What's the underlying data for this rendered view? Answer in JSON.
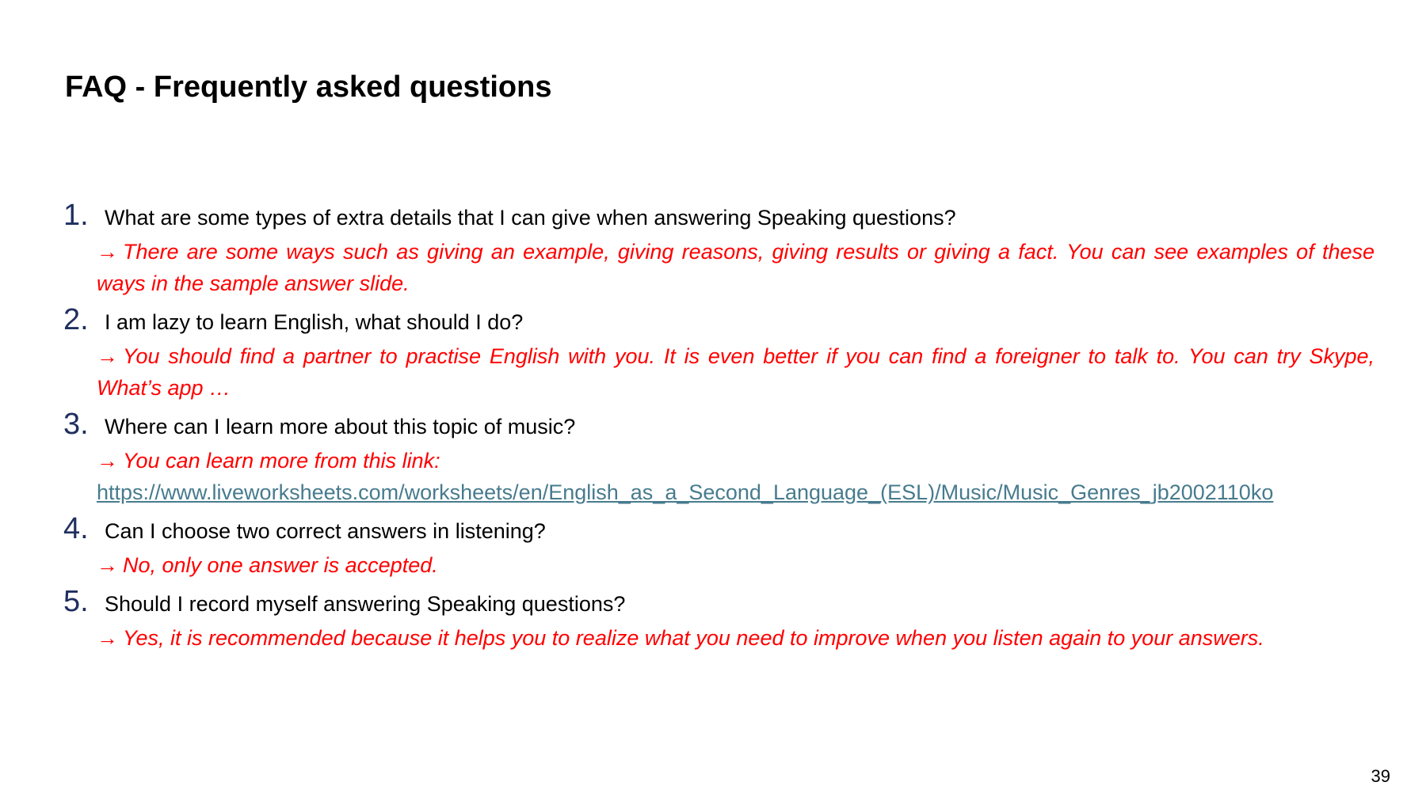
{
  "slide": {
    "title": "FAQ - Frequently asked questions",
    "page_number": "39",
    "colors": {
      "number": "#1f2f5e",
      "question": "#000000",
      "answer": "#ff0000",
      "link": "#477b8e"
    },
    "arrow_glyph": "→",
    "faq": [
      {
        "number": "1.",
        "question": "What are some types of extra details that I can give when answering Speaking questions?",
        "answer": "There are some ways such as giving an example, giving reasons, giving results or giving a fact. You can see examples of these ways in the sample answer slide."
      },
      {
        "number": "2.",
        "question": "I am lazy to learn English, what should I do?",
        "answer": "You should find a partner to practise English with you. It is even better if you can find a foreigner to talk to. You can try Skype, What’s app …"
      },
      {
        "number": "3.",
        "question": "Where can I learn more about this topic of music?",
        "answer": "You can learn more from this link:",
        "link": "https://www.liveworksheets.com/worksheets/en/English_as_a_Second_Language_(ESL)/Music/Music_Genres_jb2002110ko"
      },
      {
        "number": "4.",
        "question": "Can I choose two correct answers in listening?",
        "answer": "No, only one answer is accepted."
      },
      {
        "number": "5.",
        "question": "Should I record myself answering Speaking questions?",
        "answer": "Yes, it is recommended because it helps you to realize what you need to improve when you listen again to your answers."
      }
    ]
  }
}
